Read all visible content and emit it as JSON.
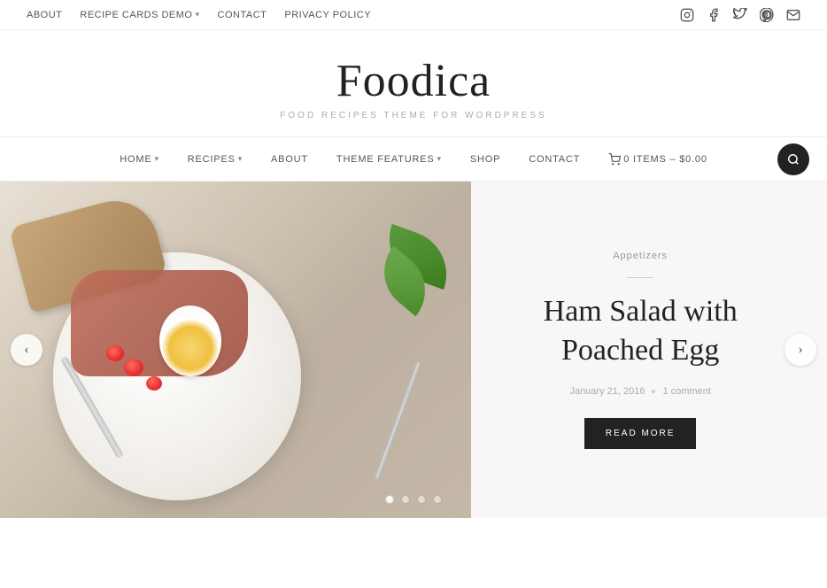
{
  "topNav": {
    "links": [
      {
        "label": "ABOUT",
        "name": "about",
        "hasDropdown": false
      },
      {
        "label": "RECIPE CARDS DEMO",
        "name": "recipe-cards-demo",
        "hasDropdown": true
      },
      {
        "label": "CONTACT",
        "name": "contact",
        "hasDropdown": false
      },
      {
        "label": "PRIVACY POLICY",
        "name": "privacy-policy",
        "hasDropdown": false
      }
    ],
    "socialIcons": [
      {
        "name": "instagram-icon",
        "symbol": "📷"
      },
      {
        "name": "facebook-icon",
        "symbol": "f"
      },
      {
        "name": "twitter-icon",
        "symbol": "𝕏"
      },
      {
        "name": "pinterest-icon",
        "symbol": "P"
      },
      {
        "name": "email-icon",
        "symbol": "✉"
      }
    ]
  },
  "logo": {
    "title": "Foodica",
    "subtitle": "FOOD RECIPES THEME FOR WORDPRESS"
  },
  "mainNav": {
    "links": [
      {
        "label": "HOME",
        "name": "home",
        "hasDropdown": true
      },
      {
        "label": "RECIPES",
        "name": "recipes",
        "hasDropdown": true
      },
      {
        "label": "ABOUT",
        "name": "about",
        "hasDropdown": false
      },
      {
        "label": "THEME FEATURES",
        "name": "theme-features",
        "hasDropdown": true
      },
      {
        "label": "SHOP",
        "name": "shop",
        "hasDropdown": false
      },
      {
        "label": "CONTACT",
        "name": "contact",
        "hasDropdown": false
      },
      {
        "label": "0 ITEMS – $0.00",
        "name": "cart",
        "hasDropdown": false
      }
    ]
  },
  "hero": {
    "category": "Appetizers",
    "title": "Ham Salad with Poached Egg",
    "date": "January 21, 2016",
    "comments": "1 comment",
    "readMoreLabel": "READ MORE"
  },
  "slider": {
    "dots": [
      {
        "active": true
      },
      {
        "active": false
      },
      {
        "active": false
      },
      {
        "active": false
      }
    ],
    "prevLabel": "‹",
    "nextLabel": "›"
  }
}
